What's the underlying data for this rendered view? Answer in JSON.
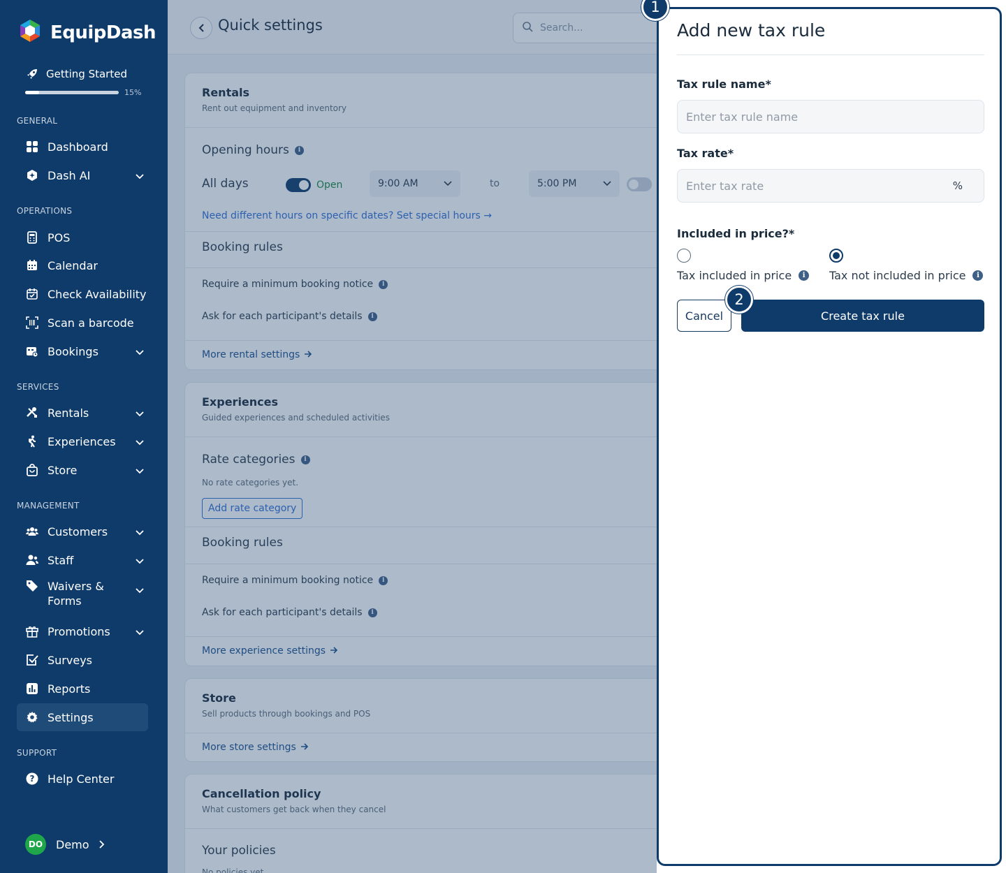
{
  "brand": {
    "name": "EquipDash"
  },
  "getting_started": {
    "label": "Getting Started",
    "progress_label": "15%",
    "progress": 0.15
  },
  "sidebar": {
    "sections": {
      "general": "GENERAL",
      "operations": "OPERATIONS",
      "services": "SERVICES",
      "management": "MANAGEMENT",
      "support": "SUPPORT"
    },
    "items": {
      "dashboard": "Dashboard",
      "dash_ai": "Dash AI",
      "pos": "POS",
      "calendar": "Calendar",
      "check_availability": "Check Availability",
      "scan_barcode": "Scan a barcode",
      "bookings": "Bookings",
      "rentals": "Rentals",
      "experiences": "Experiences",
      "store": "Store",
      "customers": "Customers",
      "staff": "Staff",
      "waivers_line1": "Waivers &",
      "waivers_line2": "Forms",
      "promotions": "Promotions",
      "surveys": "Surveys",
      "reports": "Reports",
      "settings": "Settings",
      "help_center": "Help Center"
    },
    "user": {
      "initials": "DO",
      "name": "Demo"
    }
  },
  "main": {
    "title": "Quick settings",
    "search_placeholder": "Search...",
    "rentals": {
      "title": "Rentals",
      "subtitle": "Rent out equipment and inventory",
      "opening_hours": "Opening hours",
      "all_days": "All days",
      "open_label": "Open",
      "start_time": "9:00 AM",
      "to": "to",
      "end_time": "5:00 PM",
      "special_hours_link": "Need different hours on specific dates? Set special hours →",
      "booking_rules": "Booking rules",
      "rule_notice": "Require a minimum booking notice",
      "rule_participants": "Ask for each participant's details",
      "more_link": "More rental settings"
    },
    "experiences": {
      "title": "Experiences",
      "subtitle": "Guided experiences and scheduled activities",
      "rate_categories": "Rate categories",
      "no_rate": "No rate categories yet.",
      "add_rate": "Add rate category",
      "booking_rules": "Booking rules",
      "rule_notice": "Require a minimum booking notice",
      "rule_participants": "Ask for each participant's details",
      "more_link": "More experience settings"
    },
    "store": {
      "title": "Store",
      "subtitle": "Sell products through bookings and POS",
      "more_link": "More store settings"
    },
    "cancellation": {
      "title": "Cancellation policy",
      "subtitle": "What customers get back when they cancel",
      "your_policies": "Your policies",
      "no_policies": "No policies yet."
    }
  },
  "panel": {
    "title": "Add new tax rule",
    "name_label": "Tax rule name*",
    "name_placeholder": "Enter tax rule name",
    "rate_label": "Tax rate*",
    "rate_placeholder": "Enter tax rate",
    "rate_suffix": "%",
    "included_label": "Included in price?*",
    "option_included": "Tax included in price",
    "option_not_included": "Tax not included in price",
    "selected_option": "not_included",
    "cancel": "Cancel",
    "create": "Create tax rule"
  },
  "callouts": {
    "one": "1",
    "two": "2"
  },
  "colors": {
    "navy": "#0f3b6a",
    "link_blue": "#2f6fd3",
    "avatar_green": "#1fa64a"
  }
}
